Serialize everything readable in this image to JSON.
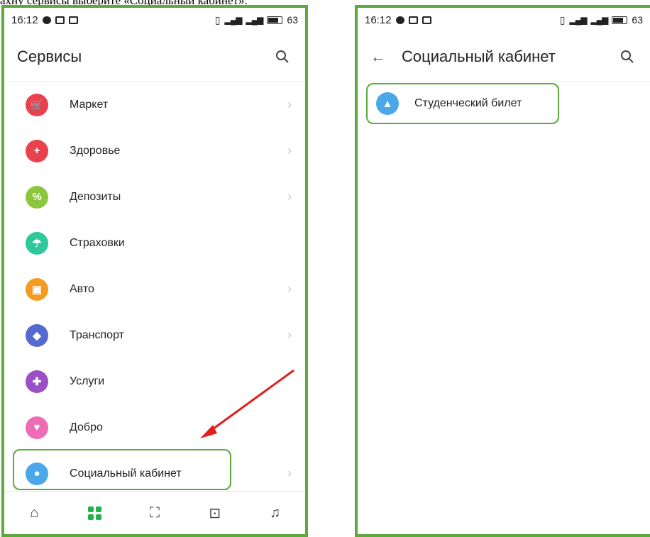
{
  "caption": "ахну сервисы выберите «Социальный кабинет».",
  "status": {
    "time": "16:12",
    "battery": "63"
  },
  "left": {
    "title": "Сервисы",
    "items": [
      {
        "label": "Маркет",
        "icon": "cart-icon",
        "color": "#e8424e",
        "glyph": "🛒",
        "chevron": true
      },
      {
        "label": "Здоровье",
        "icon": "plus-icon",
        "color": "#e8424e",
        "glyph": "+",
        "chevron": true
      },
      {
        "label": "Депозиты",
        "icon": "percent-icon",
        "color": "#8bc63e",
        "glyph": "%",
        "chevron": true
      },
      {
        "label": "Страховки",
        "icon": "umbrella-icon",
        "color": "#2fc89a",
        "glyph": "☂",
        "chevron": false
      },
      {
        "label": "Авто",
        "icon": "car-icon",
        "color": "#f59b1e",
        "glyph": "▣",
        "chevron": true
      },
      {
        "label": "Транспорт",
        "icon": "transport-icon",
        "color": "#5569d0",
        "glyph": "◆",
        "chevron": true
      },
      {
        "label": "Услуги",
        "icon": "puzzle-icon",
        "color": "#9b4fc4",
        "glyph": "✚",
        "chevron": false
      },
      {
        "label": "Добро",
        "icon": "heart-icon",
        "color": "#f06bb5",
        "glyph": "♥",
        "chevron": false
      },
      {
        "label": "Социальный кабинет",
        "icon": "person-icon",
        "color": "#4aa8e8",
        "glyph": "●",
        "chevron": true
      }
    ],
    "nav": [
      {
        "name": "nav-home",
        "icon": "home-icon",
        "glyph": "⌂"
      },
      {
        "name": "nav-services",
        "icon": "grid-icon",
        "glyph": ""
      },
      {
        "name": "nav-scan",
        "icon": "scan-icon",
        "glyph": "⛶"
      },
      {
        "name": "nav-inbox",
        "icon": "inbox-icon",
        "glyph": "⊡"
      },
      {
        "name": "nav-notifications",
        "icon": "bell-icon",
        "glyph": "♫"
      }
    ]
  },
  "right": {
    "title": "Социальный кабинет",
    "items": [
      {
        "label": "Студенческий билет",
        "icon": "graduation-cap-icon",
        "color": "#4aa8e8",
        "glyph": "▲"
      }
    ]
  },
  "colors": {
    "highlight": "#5aaa3c",
    "arrow": "#e0201e"
  }
}
